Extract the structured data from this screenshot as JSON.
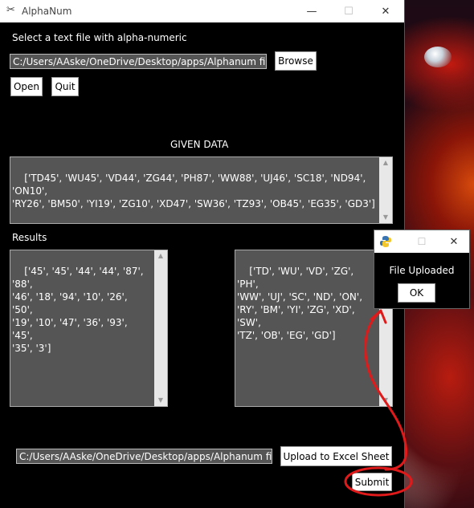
{
  "main_window": {
    "title": "AlphaNum",
    "prompt": "Select a text file with alpha-numeric",
    "file_path": "C:/Users/AAske/OneDrive/Desktop/apps/Alphanum file",
    "browse_label": "Browse",
    "open_label": "Open",
    "quit_label": "Quit",
    "given_data_heading": "GIVEN DATA",
    "given_data_text": "['TD45', 'WU45', 'VD44', 'ZG44', 'PH87', 'WW88', 'UJ46', 'SC18', 'ND94', 'ON10',\n'RY26', 'BM50', 'YI19', 'ZG10', 'XD47', 'SW36', 'TZ93', 'OB45', 'EG35', 'GD3']",
    "results_label": "Results",
    "numbers_text": "['45', '45', '44', '44', '87', '88',\n'46', '18', '94', '10', '26', '50',\n'19', '10', '47', '36', '93', '45',\n'35', '3']",
    "letters_text": "['TD', 'WU', 'VD', 'ZG', 'PH',\n'WW', 'UJ', 'SC', 'ND', 'ON',\n'RY', 'BM', 'YI', 'ZG', 'XD', 'SW',\n'TZ', 'OB', 'EG', 'GD']",
    "output_path": "C:/Users/AAske/OneDrive/Desktop/apps/Alphanum file",
    "upload_label": "Upload to Excel Sheet",
    "submit_label": "Submit"
  },
  "popup": {
    "message": "File Uploaded",
    "ok_label": "OK"
  },
  "colors": {
    "window_bg": "#000000",
    "field_bg": "#555555",
    "annotation_red": "#e01a1a"
  },
  "icons": {
    "app": "scissors-icon",
    "popup": "python-logo-icon"
  }
}
